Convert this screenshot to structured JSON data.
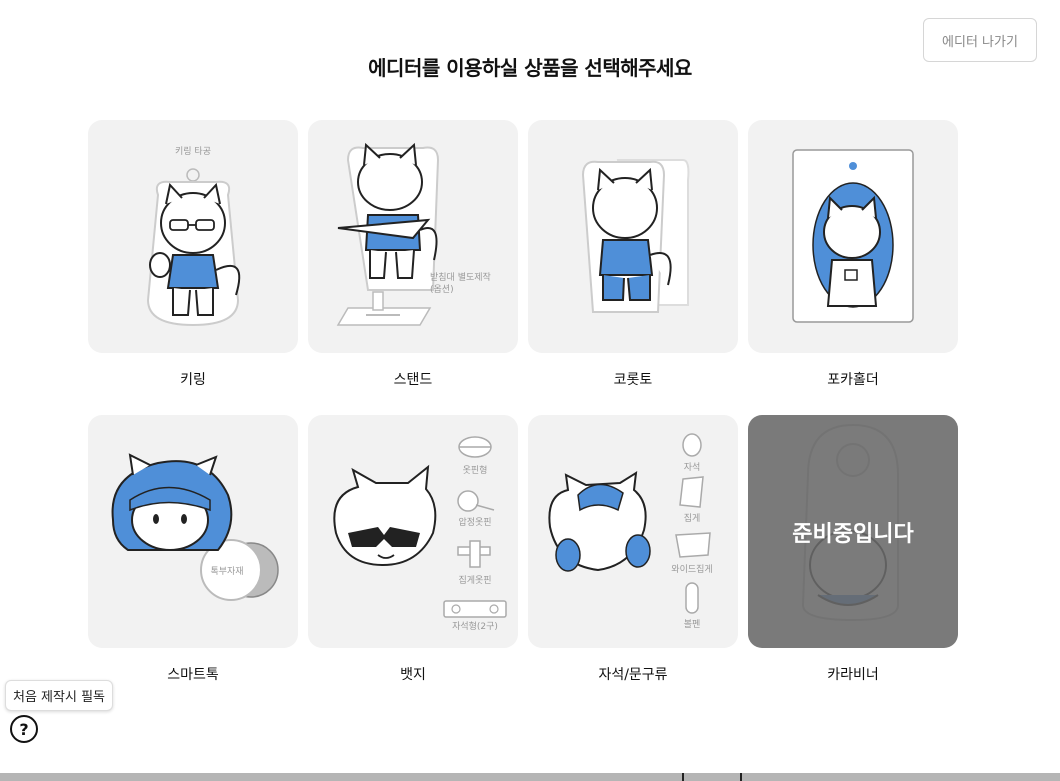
{
  "header": {
    "exit_label": "에디터 나가기",
    "title": "에디터를 이용하실 상품을 선택해주세요"
  },
  "products": [
    {
      "label": "키링",
      "annotations": [
        "키링 타공"
      ]
    },
    {
      "label": "스탠드",
      "annotations": [
        "받침대 별도제작",
        "(옵션)"
      ]
    },
    {
      "label": "코롯토",
      "annotations": []
    },
    {
      "label": "포카홀더",
      "annotations": []
    },
    {
      "label": "스마트톡",
      "annotations": [
        "톡부자재"
      ]
    },
    {
      "label": "뱃지",
      "annotations": [
        "옷핀형",
        "압정옷핀",
        "집게옷핀",
        "자석형(2구)"
      ]
    },
    {
      "label": "자석/문구류",
      "annotations": [
        "자석",
        "집게",
        "와이드집게",
        "볼펜"
      ]
    },
    {
      "label": "카라비너",
      "annotations": [],
      "overlay": "준비중입니다"
    }
  ],
  "help": {
    "tooltip": "처음 제작시 필독",
    "icon": "question-circle-icon"
  },
  "colors": {
    "accent_blue": "#4f8fd8",
    "card_bg": "#f2f2f2",
    "overlay_bg": "#6a6a6a"
  }
}
